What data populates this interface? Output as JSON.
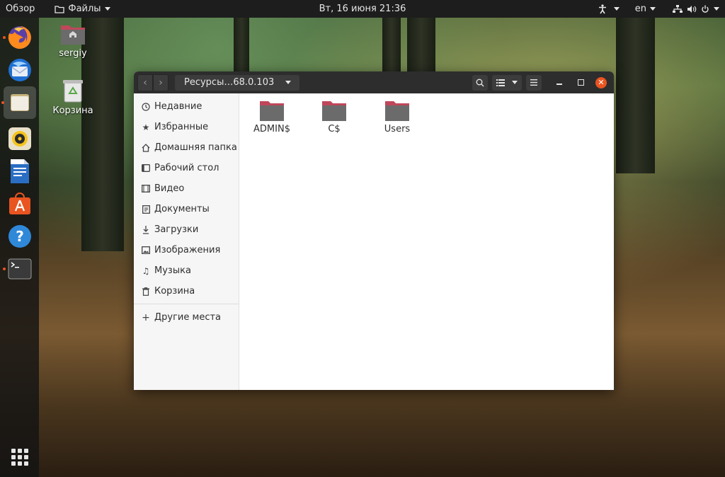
{
  "topbar": {
    "activities": "Обзор",
    "app_menu": "Файлы",
    "clock": "Вт, 16 июня  21:36",
    "lang": "en"
  },
  "desktop": {
    "icons": [
      {
        "label": "sergiy"
      },
      {
        "label": "Корзина"
      }
    ]
  },
  "window": {
    "path": "Ресурсы…68.0.103",
    "sidebar": {
      "items": [
        {
          "label": "Недавние",
          "icon": "clock-icon"
        },
        {
          "label": "Избранные",
          "icon": "star-icon"
        },
        {
          "label": "Домашняя папка",
          "icon": "home-icon"
        },
        {
          "label": "Рабочий стол",
          "icon": "desktop-icon"
        },
        {
          "label": "Видео",
          "icon": "video-icon"
        },
        {
          "label": "Документы",
          "icon": "document-icon"
        },
        {
          "label": "Загрузки",
          "icon": "download-icon"
        },
        {
          "label": "Изображения",
          "icon": "image-icon"
        },
        {
          "label": "Музыка",
          "icon": "music-icon"
        },
        {
          "label": "Корзина",
          "icon": "trash-icon"
        }
      ],
      "other": {
        "label": "Другие места",
        "icon": "plus-icon"
      }
    },
    "folders": [
      {
        "name": "ADMIN$"
      },
      {
        "name": "C$"
      },
      {
        "name": "Users"
      }
    ]
  },
  "colors": {
    "accent": "#e95420",
    "header": "#2d2d2d",
    "topbar": "#1d1d1d",
    "folder": "#6b6b6b",
    "folder_tab": "#c0475a"
  }
}
